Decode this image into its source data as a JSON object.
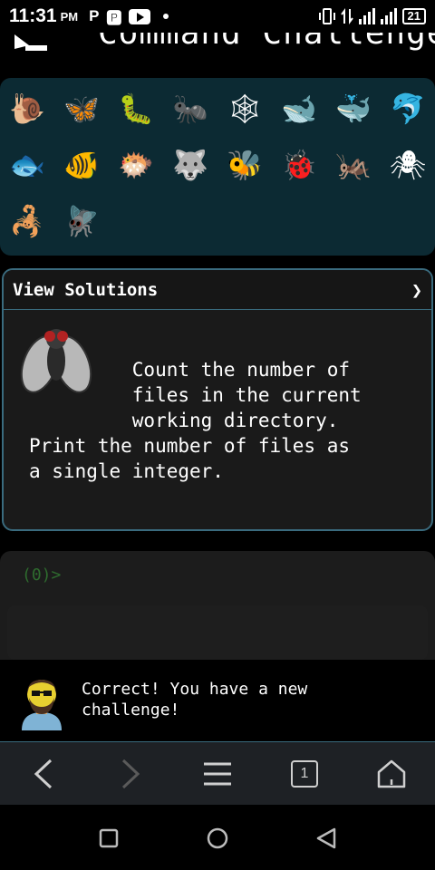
{
  "status_bar": {
    "time": "11:31",
    "ampm": "PM",
    "left_icons": [
      "p-icon",
      "parking-icon",
      "youtube-icon",
      "dot-icon"
    ],
    "battery": "21"
  },
  "header": {
    "title": "Command Challenge",
    "menu_icon": "menu-icon"
  },
  "creatures": [
    {
      "name": "snail-icon",
      "glyph": "🐌"
    },
    {
      "name": "butterfly-icon",
      "glyph": "🦋"
    },
    {
      "name": "caterpillar-icon",
      "glyph": "🐛"
    },
    {
      "name": "ant-icon",
      "glyph": "🐜"
    },
    {
      "name": "spider-web-icon",
      "glyph": "🕸"
    },
    {
      "name": "whale-icon",
      "glyph": "🐋"
    },
    {
      "name": "spouting-whale-icon",
      "glyph": "🐳"
    },
    {
      "name": "dolphin-icon",
      "glyph": "🐬"
    },
    {
      "name": "fish-icon",
      "glyph": "🐟"
    },
    {
      "name": "tropical-fish-icon",
      "glyph": "🐠"
    },
    {
      "name": "blowfish-icon",
      "glyph": "🐡"
    },
    {
      "name": "wolf-icon",
      "glyph": "🐺"
    },
    {
      "name": "bee-icon",
      "glyph": "🐝"
    },
    {
      "name": "ladybug-icon",
      "glyph": "🐞"
    },
    {
      "name": "cricket-icon",
      "glyph": "🦗"
    },
    {
      "name": "spider-icon",
      "glyph": "🕷"
    },
    {
      "name": "scorpion-icon",
      "glyph": "🦂"
    },
    {
      "name": "fly-icon",
      "glyph": "🪰"
    }
  ],
  "card": {
    "header_label": "View Solutions",
    "chevron": "❯",
    "challenge_text": "         Count the number of\n         files in the current\n         working directory.\nPrint the number of files as\na single integer."
  },
  "terminal": {
    "prompt": "(0)>"
  },
  "message": {
    "text": "Correct! You have a new\nchallenge!"
  },
  "browser_bar": {
    "tab_count": "1"
  },
  "colors": {
    "panel_bg": "#0c2a33",
    "card_border": "#3a6b7e",
    "prompt_green": "#2e6b2e"
  }
}
